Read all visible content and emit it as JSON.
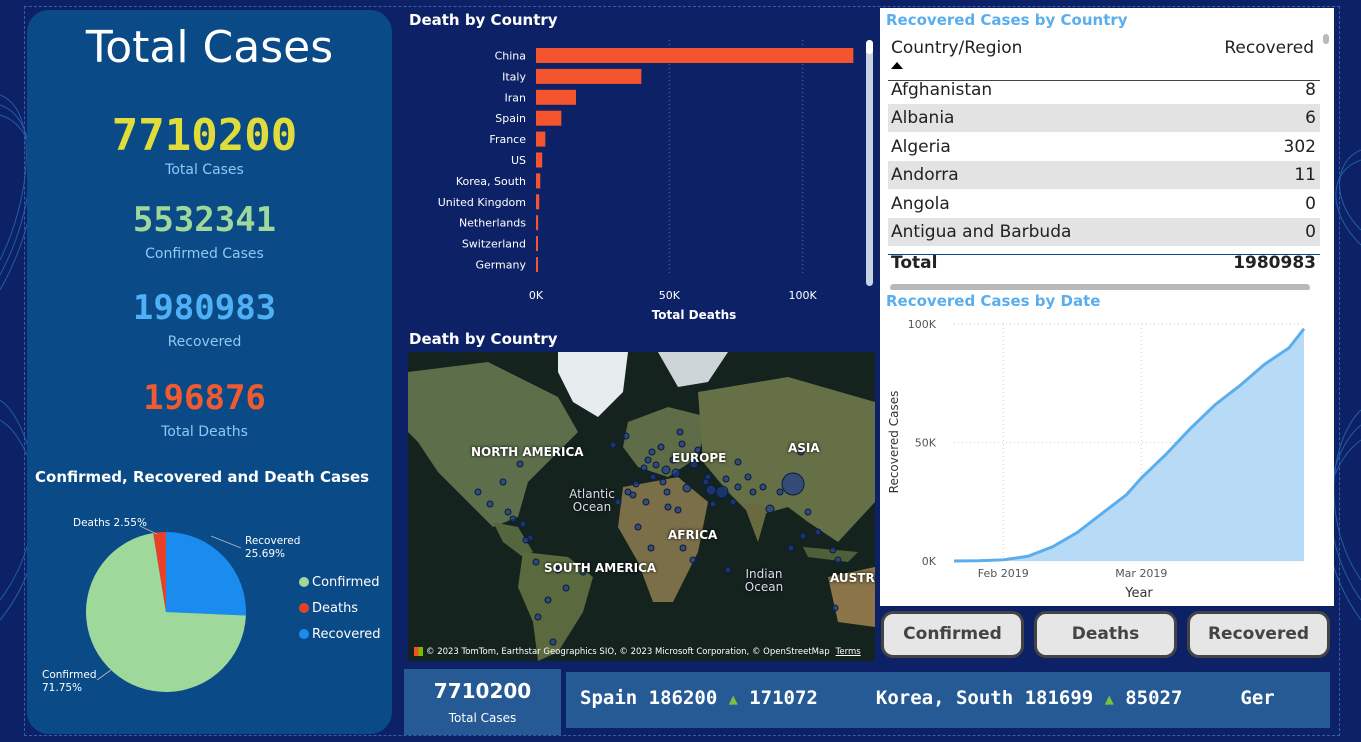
{
  "kpi": {
    "title": "Total Cases",
    "total_cases": {
      "value": "7710200",
      "label": "Total Cases",
      "color": "#dfdc3c"
    },
    "confirmed": {
      "value": "5532341",
      "label": "Confirmed Cases",
      "color": "#9ed89a"
    },
    "recovered": {
      "value": "1980983",
      "label": "Recovered",
      "color": "#4fb0f5"
    },
    "deaths": {
      "value": "196876",
      "label": "Total Deaths",
      "color": "#f05a30"
    }
  },
  "pie_title": "Confirmed, Recovered and Death Cases",
  "bar_title": "Death by Country",
  "map": {
    "title": "Death by Country",
    "labels": [
      "NORTH AMERICA",
      "EUROPE",
      "ASIA",
      "AFRICA",
      "SOUTH AMERICA",
      "AUSTRA"
    ],
    "oceans": [
      "Atlantic Ocean",
      "Indian Ocean"
    ],
    "copyright": "© 2023 TomTom, Earthstar Geographics SIO, © 2023 Microsoft Corporation, © OpenStreetMap",
    "terms": "Terms"
  },
  "table": {
    "title": "Recovered Cases by Country",
    "col_country": "Country/Region",
    "col_recovered": "Recovered",
    "rows": [
      {
        "country": "Afghanistan",
        "recovered": "8"
      },
      {
        "country": "Albania",
        "recovered": "6"
      },
      {
        "country": "Algeria",
        "recovered": "302"
      },
      {
        "country": "Andorra",
        "recovered": "11"
      },
      {
        "country": "Angola",
        "recovered": "0"
      },
      {
        "country": "Antigua and Barbuda",
        "recovered": "0"
      }
    ],
    "total_label": "Total",
    "total_value": "1980983"
  },
  "line_title": "Recovered Cases by Date",
  "buttons": {
    "confirmed": "Confirmed",
    "deaths": "Deaths",
    "recovered": "Recovered"
  },
  "bottom_kpi": {
    "value": "7710200",
    "label": "Total Cases"
  },
  "ticker": [
    {
      "country": "Spain",
      "value": "186200",
      "change": "171072"
    },
    {
      "country": "Korea, South",
      "value": "181699",
      "change": "85027"
    },
    {
      "country": "Ger",
      "value": "",
      "change": ""
    }
  ],
  "colors": {
    "bar": "#f4552e",
    "pie_confirmed": "#9ed89a",
    "pie_deaths": "#e8412a",
    "pie_recovered": "#1a8cf0",
    "area": "#b7dbf6",
    "line": "#5aaeee"
  },
  "chart_data": [
    {
      "type": "bar",
      "title": "Death by Country",
      "xlabel": "Total Deaths",
      "ylabel": "",
      "categories": [
        "China",
        "Italy",
        "Iran",
        "Spain",
        "France",
        "US",
        "Korea, South",
        "United Kingdom",
        "Netherlands",
        "Switzerland",
        "Germany"
      ],
      "values": [
        119000,
        39500,
        15000,
        9500,
        3500,
        2300,
        1600,
        1200,
        800,
        500,
        400
      ],
      "xlim": [
        0,
        120000
      ],
      "xticks": [
        "0K",
        "50K",
        "100K"
      ],
      "xtick_values": [
        0,
        50000,
        100000
      ]
    },
    {
      "type": "pie",
      "title": "Confirmed, Recovered and Death Cases",
      "categories": [
        "Confirmed",
        "Deaths",
        "Recovered"
      ],
      "values": [
        71.75,
        2.55,
        25.69
      ],
      "data_labels": [
        "Confirmed 71.75%",
        "Deaths 2.55%",
        "Recovered 25.69%"
      ],
      "legend": "right"
    },
    {
      "type": "area",
      "title": "Recovered Cases by Date",
      "xlabel": "Year",
      "ylabel": "Recovered Cases",
      "yticks": [
        "0K",
        "50K",
        "100K"
      ],
      "ytick_values": [
        0,
        50000,
        100000
      ],
      "ylim": [
        0,
        100000
      ],
      "xticks": [
        "Feb 2019",
        "Mar 2019"
      ],
      "x": [
        "2019-01-22",
        "2019-01-27",
        "2019-02-01",
        "2019-02-06",
        "2019-02-11",
        "2019-02-16",
        "2019-02-21",
        "2019-02-26",
        "2019-03-01",
        "2019-03-06",
        "2019-03-11",
        "2019-03-16",
        "2019-03-21",
        "2019-03-26",
        "2019-03-31",
        "2019-04-03"
      ],
      "values": [
        0,
        100,
        500,
        2000,
        6000,
        12000,
        20000,
        28000,
        35000,
        45000,
        56000,
        66000,
        74000,
        83000,
        90000,
        98000
      ]
    }
  ]
}
